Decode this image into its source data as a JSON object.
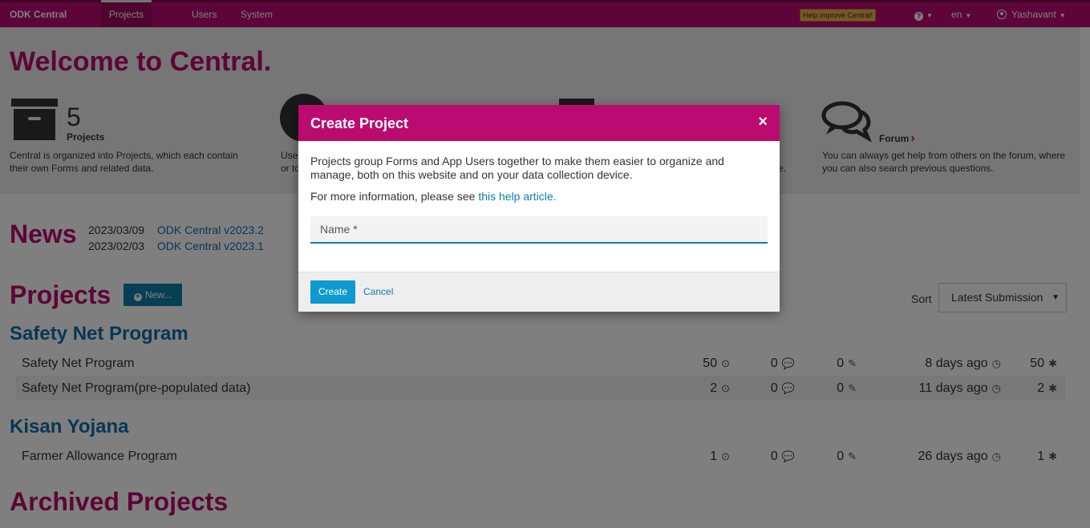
{
  "navbar": {
    "brand": "ODK Central",
    "items": [
      {
        "label": "Projects"
      },
      {
        "label": "Users"
      },
      {
        "label": "System"
      }
    ],
    "help_badge": "Help improve Central!",
    "help_icon": "?",
    "language": "en",
    "user": "Yashavant"
  },
  "welcome": {
    "title": "Welcome to Central.",
    "projects_count": "5",
    "projects_label": "Projects",
    "projects_desc": "Central is organized into Projects, which each contain their own Forms and related data.",
    "users_desc_fragment": "Use",
    "users_desc_fragment2": "or to",
    "forms_desc_fragment": "e.",
    "forum_label": "Forum",
    "forum_desc": "You can always get help from others on the forum, where you can also search previous questions."
  },
  "news": {
    "title": "News",
    "items": [
      {
        "date": "2023/03/09",
        "link": "ODK Central v2023.2"
      },
      {
        "date": "2023/02/03",
        "link": "ODK Central v2023.1"
      }
    ]
  },
  "projects": {
    "title": "Projects",
    "new_label": "New...",
    "sort_label": "Sort",
    "sort_value": "Latest Submission",
    "groups": [
      {
        "name": "Safety Net Program",
        "forms": [
          {
            "name": "Safety Net Program",
            "forms": "50",
            "reviews": "0",
            "edits": "0",
            "last": "8 days ago",
            "total": "50"
          },
          {
            "name": "Safety Net Program(pre-populated data)",
            "forms": "2",
            "reviews": "0",
            "edits": "0",
            "last": "11 days ago",
            "total": "2"
          }
        ]
      },
      {
        "name": "Kisan Yojana",
        "forms": [
          {
            "name": "Farmer Allowance Program",
            "forms": "1",
            "reviews": "0",
            "edits": "0",
            "last": "26 days ago",
            "total": "1"
          }
        ]
      }
    ],
    "archived_title": "Archived Projects"
  },
  "modal": {
    "title": "Create Project",
    "close": "×",
    "desc": "Projects group Forms and App Users together to make them easier to organize and manage, both on this website and on your data collection device.",
    "more_info_prefix": "For more information, please see ",
    "more_info_link": "this help article.",
    "name_placeholder": "Name *",
    "name_value": "",
    "create_label": "Create",
    "cancel_label": "Cancel"
  },
  "colors": {
    "brand": "#bb0a70",
    "link": "#0e6fa8",
    "button": "#0e9ad0"
  },
  "icons": {
    "forms": "dot-circle-icon",
    "reviews": "comments-icon",
    "edits": "pencil-icon",
    "last": "clock-icon",
    "total": "asterisk-icon"
  }
}
